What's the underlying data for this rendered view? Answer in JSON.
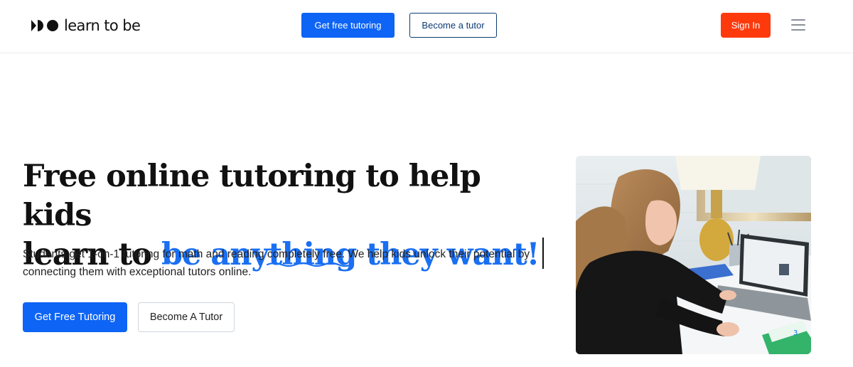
{
  "brand": {
    "name": "learn to be"
  },
  "nav": {
    "primary_label": "Get free tutoring",
    "secondary_label": "Become a tutor",
    "signin_label": "Sign In"
  },
  "hero": {
    "title_line1": "Free online tutoring to help kids",
    "title_line2_plain": "learn to ",
    "title_line2_accent": "be anything they want!",
    "subtitle_before": "Students get 1-on-1 tutoring for math and reading ",
    "subtitle_highlight": "completely free",
    "subtitle_after": ". We help kids unlock their potential by connecting them with exceptional tutors online.",
    "cta_primary": "Get Free Tutoring",
    "cta_secondary": "Become A Tutor"
  },
  "colors": {
    "brand_blue": "#0d64f5",
    "accent_text_blue": "#1a6ff2",
    "signin_orange": "#fe3a0d",
    "tutor_border_navy": "#0c3b74"
  },
  "icons": {
    "menu": "hamburger-menu-icon",
    "logo": "learn-to-be-logo-mark"
  }
}
